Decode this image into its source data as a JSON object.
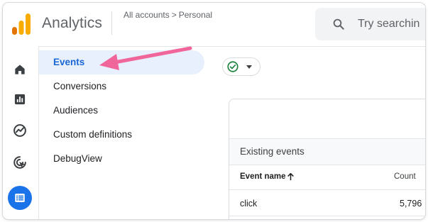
{
  "header": {
    "app_title": "Analytics",
    "breadcrumb": {
      "root": "All accounts",
      "separator": ">",
      "current": "Personal"
    },
    "search": {
      "placeholder": "Try searchin"
    }
  },
  "rail": {
    "items": [
      {
        "icon": "home-icon",
        "active": false
      },
      {
        "icon": "reports-icon",
        "active": false
      },
      {
        "icon": "explore-icon",
        "active": false
      },
      {
        "icon": "advertising-icon",
        "active": false
      },
      {
        "icon": "configure-icon",
        "active": true
      }
    ]
  },
  "subnav": {
    "items": [
      {
        "label": "Events",
        "active": true
      },
      {
        "label": "Conversions",
        "active": false
      },
      {
        "label": "Audiences",
        "active": false
      },
      {
        "label": "Custom definitions",
        "active": false
      },
      {
        "label": "DebugView",
        "active": false
      }
    ]
  },
  "status_chip": {
    "icon": "check-circle-icon",
    "caret": "caret-down-icon"
  },
  "events_card": {
    "section_title": "Existing events",
    "columns": {
      "name": "Event name",
      "count": "Count"
    },
    "rows": [
      {
        "name": "click",
        "count": "5,796"
      }
    ]
  },
  "colors": {
    "accent": "#1a73e8",
    "active_bg": "#e8f0fe",
    "active_text": "#1967d2",
    "annotation": "#f0669b",
    "logo_orange": "#f9ab00",
    "logo_dark": "#e37400",
    "success": "#188038"
  }
}
